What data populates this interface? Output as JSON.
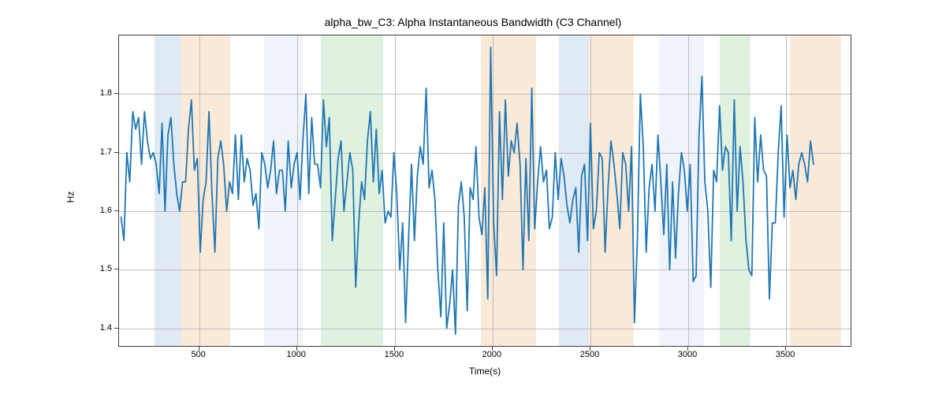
{
  "chart_data": {
    "type": "line",
    "title": "alpha_bw_C3: Alpha Instantaneous Bandwidth (C3 Channel)",
    "xlabel": "Time(s)",
    "ylabel": "Hz",
    "xlim": [
      90,
      3830
    ],
    "ylim": [
      1.37,
      1.9
    ],
    "xticks": [
      500,
      1000,
      1500,
      2000,
      2500,
      3000,
      3500
    ],
    "yticks": [
      1.4,
      1.5,
      1.6,
      1.7,
      1.8
    ],
    "shaded_regions": [
      {
        "start": 270,
        "end": 410,
        "color": "#a7c4e0"
      },
      {
        "start": 410,
        "end": 660,
        "color": "#f5c38f"
      },
      {
        "start": 830,
        "end": 1030,
        "color": "#d3dff0"
      },
      {
        "start": 1120,
        "end": 1440,
        "color": "#a6d6a6"
      },
      {
        "start": 1940,
        "end": 2220,
        "color": "#f5c38f"
      },
      {
        "start": 2340,
        "end": 2490,
        "color": "#a7c4e0"
      },
      {
        "start": 2490,
        "end": 2720,
        "color": "#f5c38f"
      },
      {
        "start": 2850,
        "end": 3080,
        "color": "#d3dff0"
      },
      {
        "start": 3160,
        "end": 3320,
        "color": "#a6d6a6"
      },
      {
        "start": 3520,
        "end": 3780,
        "color": "#f5c38f"
      }
    ],
    "series": [
      {
        "name": "alpha_bw_C3",
        "x": [
          100,
          115,
          130,
          145,
          160,
          175,
          190,
          205,
          220,
          235,
          250,
          265,
          280,
          295,
          310,
          325,
          340,
          355,
          370,
          385,
          400,
          415,
          430,
          445,
          460,
          475,
          490,
          505,
          520,
          535,
          550,
          565,
          580,
          595,
          610,
          625,
          640,
          655,
          670,
          685,
          700,
          715,
          730,
          745,
          760,
          775,
          790,
          805,
          820,
          835,
          850,
          865,
          880,
          895,
          910,
          925,
          940,
          955,
          970,
          985,
          1000,
          1015,
          1030,
          1045,
          1060,
          1075,
          1090,
          1105,
          1120,
          1135,
          1150,
          1165,
          1180,
          1195,
          1210,
          1225,
          1240,
          1255,
          1270,
          1285,
          1300,
          1315,
          1330,
          1345,
          1360,
          1375,
          1390,
          1405,
          1420,
          1435,
          1450,
          1465,
          1480,
          1495,
          1510,
          1525,
          1540,
          1555,
          1570,
          1585,
          1600,
          1615,
          1630,
          1645,
          1660,
          1675,
          1690,
          1705,
          1720,
          1735,
          1750,
          1765,
          1780,
          1795,
          1810,
          1825,
          1840,
          1855,
          1870,
          1885,
          1900,
          1915,
          1930,
          1945,
          1960,
          1975,
          1990,
          2005,
          2020,
          2035,
          2050,
          2065,
          2080,
          2095,
          2110,
          2125,
          2140,
          2155,
          2170,
          2185,
          2200,
          2215,
          2230,
          2245,
          2260,
          2275,
          2290,
          2305,
          2320,
          2335,
          2350,
          2365,
          2380,
          2395,
          2410,
          2425,
          2440,
          2455,
          2470,
          2485,
          2500,
          2515,
          2530,
          2545,
          2560,
          2575,
          2590,
          2605,
          2620,
          2635,
          2650,
          2665,
          2680,
          2695,
          2710,
          2725,
          2740,
          2755,
          2770,
          2785,
          2800,
          2815,
          2830,
          2845,
          2860,
          2875,
          2890,
          2905,
          2920,
          2935,
          2950,
          2965,
          2980,
          2995,
          3010,
          3025,
          3040,
          3055,
          3070,
          3085,
          3100,
          3115,
          3130,
          3145,
          3160,
          3175,
          3190,
          3205,
          3220,
          3235,
          3250,
          3265,
          3280,
          3295,
          3310,
          3325,
          3340,
          3355,
          3370,
          3385,
          3400,
          3415,
          3430,
          3445,
          3460,
          3475,
          3490,
          3505,
          3520,
          3535,
          3550,
          3565,
          3580,
          3595,
          3610,
          3625,
          3640,
          3655,
          3670,
          3685,
          3700,
          3715,
          3730,
          3745,
          3760,
          3775,
          3790
        ],
        "values": [
          1.59,
          1.55,
          1.7,
          1.65,
          1.77,
          1.74,
          1.76,
          1.68,
          1.77,
          1.72,
          1.69,
          1.7,
          1.68,
          1.63,
          1.75,
          1.6,
          1.73,
          1.76,
          1.68,
          1.63,
          1.6,
          1.65,
          1.65,
          1.74,
          1.79,
          1.67,
          1.69,
          1.53,
          1.62,
          1.65,
          1.77,
          1.63,
          1.53,
          1.69,
          1.72,
          1.68,
          1.6,
          1.65,
          1.63,
          1.73,
          1.62,
          1.73,
          1.65,
          1.69,
          1.67,
          1.61,
          1.63,
          1.57,
          1.7,
          1.68,
          1.64,
          1.67,
          1.72,
          1.63,
          1.67,
          1.67,
          1.6,
          1.72,
          1.64,
          1.68,
          1.7,
          1.62,
          1.72,
          1.8,
          1.63,
          1.76,
          1.68,
          1.68,
          1.64,
          1.79,
          1.71,
          1.76,
          1.55,
          1.62,
          1.69,
          1.72,
          1.6,
          1.65,
          1.7,
          1.67,
          1.47,
          1.58,
          1.65,
          1.62,
          1.72,
          1.77,
          1.65,
          1.74,
          1.63,
          1.67,
          1.58,
          1.6,
          1.59,
          1.7,
          1.63,
          1.5,
          1.58,
          1.41,
          1.55,
          1.68,
          1.55,
          1.66,
          1.71,
          1.68,
          1.81,
          1.64,
          1.67,
          1.62,
          1.5,
          1.42,
          1.58,
          1.4,
          1.44,
          1.5,
          1.39,
          1.61,
          1.65,
          1.59,
          1.43,
          1.64,
          1.62,
          1.71,
          1.59,
          1.56,
          1.64,
          1.45,
          1.88,
          1.58,
          1.49,
          1.77,
          1.62,
          1.79,
          1.66,
          1.72,
          1.7,
          1.75,
          1.68,
          1.5,
          1.69,
          1.55,
          1.81,
          1.57,
          1.65,
          1.71,
          1.65,
          1.67,
          1.57,
          1.59,
          1.7,
          1.62,
          1.69,
          1.66,
          1.61,
          1.58,
          1.62,
          1.64,
          1.53,
          1.66,
          1.68,
          1.55,
          1.75,
          1.57,
          1.6,
          1.7,
          1.69,
          1.53,
          1.64,
          1.72,
          1.68,
          1.63,
          1.57,
          1.7,
          1.68,
          1.6,
          1.71,
          1.41,
          1.55,
          1.8,
          1.71,
          1.53,
          1.64,
          1.68,
          1.6,
          1.73,
          1.65,
          1.56,
          1.68,
          1.5,
          1.65,
          1.52,
          1.63,
          1.7,
          1.67,
          1.6,
          1.68,
          1.48,
          1.49,
          1.73,
          1.83,
          1.65,
          1.6,
          1.47,
          1.67,
          1.65,
          1.78,
          1.67,
          1.71,
          1.7,
          1.55,
          1.79,
          1.6,
          1.71,
          1.65,
          1.55,
          1.5,
          1.49,
          1.76,
          1.65,
          1.73,
          1.67,
          1.66,
          1.45,
          1.58,
          1.58,
          1.7,
          1.78,
          1.59,
          1.73,
          1.64,
          1.67,
          1.62,
          1.68,
          1.7,
          1.68,
          1.65,
          1.72,
          1.68
        ]
      }
    ]
  }
}
